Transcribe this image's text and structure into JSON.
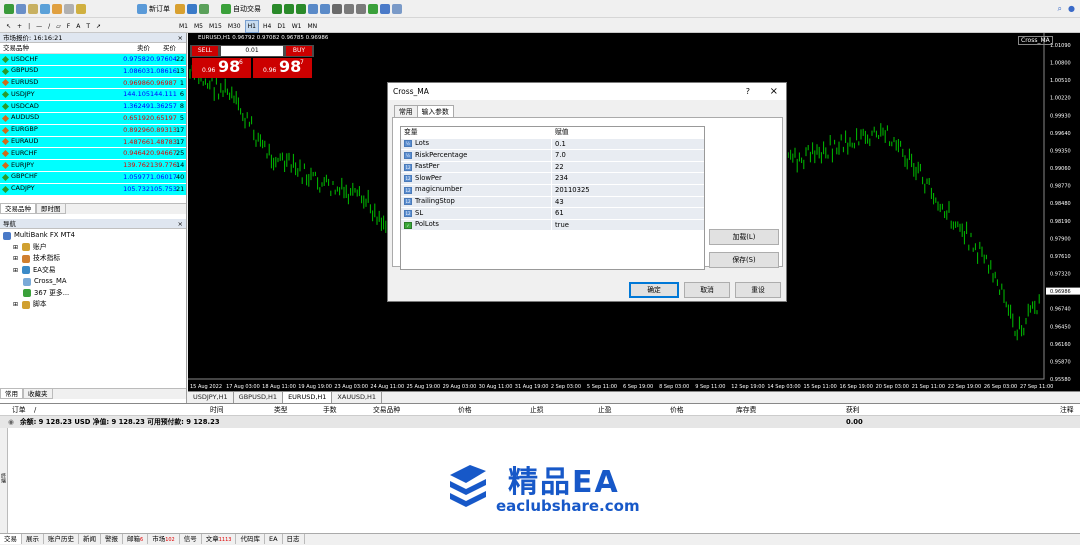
{
  "toolbar": {
    "new_order": "新订单",
    "auto_trading": "自动交易",
    "timeframes": [
      "M1",
      "M5",
      "M15",
      "M30",
      "H1",
      "H4",
      "D1",
      "W1",
      "MN"
    ]
  },
  "market_watch": {
    "title": "市场报价: 16:16:21",
    "close": "×",
    "headers": {
      "symbol": "交易品种",
      "bid": "卖价",
      "ask": "买价",
      "spread": ""
    },
    "rows": [
      {
        "symbol": "USDCHF",
        "bid": "0.97582",
        "ask": "0.97604",
        "spread": "22",
        "dir": "up"
      },
      {
        "symbol": "GBPUSD",
        "bid": "1.08603",
        "ask": "1.08616",
        "spread": "13",
        "dir": "up"
      },
      {
        "symbol": "EURUSD",
        "bid": "0.96986",
        "ask": "0.96987",
        "spread": "1",
        "dir": "down"
      },
      {
        "symbol": "USDJPY",
        "bid": "144.105",
        "ask": "144.111",
        "spread": "6",
        "dir": "up"
      },
      {
        "symbol": "USDCAD",
        "bid": "1.36249",
        "ask": "1.36257",
        "spread": "8",
        "dir": "up"
      },
      {
        "symbol": "AUDUSD",
        "bid": "0.65192",
        "ask": "0.65197",
        "spread": "5",
        "dir": "down"
      },
      {
        "symbol": "EURGBP",
        "bid": "0.89296",
        "ask": "0.89313",
        "spread": "17",
        "dir": "down"
      },
      {
        "symbol": "EURAUD",
        "bid": "1.48766",
        "ask": "1.48783",
        "spread": "17",
        "dir": "down"
      },
      {
        "symbol": "EURCHF",
        "bid": "0.94642",
        "ask": "0.94667",
        "spread": "25",
        "dir": "down"
      },
      {
        "symbol": "EURJPY",
        "bid": "139.762",
        "ask": "139.776",
        "spread": "14",
        "dir": "down"
      },
      {
        "symbol": "GBPCHF",
        "bid": "1.05977",
        "ask": "1.06017",
        "spread": "40",
        "dir": "up"
      },
      {
        "symbol": "CADJPY",
        "bid": "105.732",
        "ask": "105.753",
        "spread": "21",
        "dir": "up"
      }
    ],
    "tabs": [
      "交易品种",
      "即时图"
    ]
  },
  "navigator": {
    "title": "导航",
    "close": "×",
    "items": [
      {
        "label": "MultiBank FX MT4",
        "indent": 0,
        "icon": "terminal-icon"
      },
      {
        "label": "账户",
        "indent": 1,
        "icon": "accounts-icon"
      },
      {
        "label": "技术指标",
        "indent": 1,
        "icon": "indicators-icon"
      },
      {
        "label": "EA交易",
        "indent": 1,
        "icon": "expert-advisors-icon"
      },
      {
        "label": "Cross_MA",
        "indent": 2,
        "icon": "ea-icon"
      },
      {
        "label": "367 更多...",
        "indent": 2,
        "icon": "more-icon"
      },
      {
        "label": "脚本",
        "indent": 1,
        "icon": "scripts-icon"
      }
    ],
    "tabs": [
      "常用",
      "收藏夹"
    ]
  },
  "chart": {
    "header": "EURUSD,H1  0.96792 0.97082 0.96785 0.96986",
    "corner_label": "Cross_MA",
    "current_price": "0.96986",
    "sell": {
      "label": "SELL",
      "prefix": "0.96",
      "big": "98",
      "sup": "6"
    },
    "buy": {
      "label": "BUY",
      "prefix": "0.96",
      "big": "98",
      "sup": "7"
    },
    "lot": "0.01",
    "price_labels": [
      "1.01090",
      "1.00800",
      "1.00510",
      "1.00220",
      "0.99930",
      "0.99640",
      "0.99350",
      "0.99060",
      "0.98770",
      "0.98480",
      "0.98190",
      "0.97900",
      "0.97610",
      "0.97320",
      "0.96986",
      "0.96740",
      "0.96450",
      "0.96160",
      "0.95870",
      "0.95580"
    ],
    "time_labels": [
      "15 Aug 2022",
      "17 Aug 03:00",
      "18 Aug 11:00",
      "19 Aug 19:00",
      "23 Aug 03:00",
      "24 Aug 11:00",
      "25 Aug 19:00",
      "29 Aug 03:00",
      "30 Aug 11:00",
      "31 Aug 19:00",
      "2 Sep 03:00",
      "5 Sep 11:00",
      "6 Sep 19:00",
      "8 Sep 03:00",
      "9 Sep 11:00",
      "12 Sep 19:00",
      "14 Sep 03:00",
      "15 Sep 11:00",
      "16 Sep 19:00",
      "20 Sep 03:00",
      "21 Sep 11:00",
      "22 Sep 19:00",
      "26 Sep 03:00",
      "27 Sep 11:00"
    ],
    "tabs": [
      "USDJPY,H1",
      "GBPUSD,H1",
      "EURUSD,H1",
      "XAUUSD,H1"
    ],
    "active_tab": 2
  },
  "dialog": {
    "title": "Cross_MA",
    "help": "?",
    "close": "×",
    "tabs": [
      "常用",
      "输入参数"
    ],
    "active_tab": 1,
    "headers": {
      "name": "变量",
      "value": "赋值"
    },
    "params": [
      {
        "name": "Lots",
        "value": "0.1",
        "type": "num"
      },
      {
        "name": "RiskPercentage",
        "value": "7.0",
        "type": "num"
      },
      {
        "name": "FastPer",
        "value": "22",
        "type": "int"
      },
      {
        "name": "SlowPer",
        "value": "234",
        "type": "int"
      },
      {
        "name": "magicnumber",
        "value": "20110325",
        "type": "int"
      },
      {
        "name": "TrailingStop",
        "value": "43",
        "type": "int"
      },
      {
        "name": "SL",
        "value": "61",
        "type": "int"
      },
      {
        "name": "PolLots",
        "value": "true",
        "type": "bool"
      }
    ],
    "load_label": "加载(L)",
    "save_label": "保存(S)",
    "ok_label": "确定",
    "cancel_label": "取消",
    "reset_label": "重设"
  },
  "terminal": {
    "headers": [
      "订单",
      "/",
      "时间",
      "类型",
      "手数",
      "交易品种",
      "价格",
      "止损",
      "止盈",
      "价格",
      "库存费",
      "获利",
      "注释"
    ],
    "balance_text": "余额: 9 128.23 USD  净值: 9 128.23  可用预付款: 9 128.23",
    "profit": "0.00",
    "tabs": [
      {
        "label": "交易"
      },
      {
        "label": "展示"
      },
      {
        "label": "账户历史"
      },
      {
        "label": "新闻"
      },
      {
        "label": "警报"
      },
      {
        "label": "邮箱",
        "badge": "6"
      },
      {
        "label": "市场",
        "badge": "102"
      },
      {
        "label": "信号"
      },
      {
        "label": "文章",
        "badge": "1113"
      },
      {
        "label": "代码库"
      },
      {
        "label": "EA"
      },
      {
        "label": "日志"
      }
    ],
    "side_label": "终端"
  },
  "watermark": {
    "title": "精品EA",
    "url": "eaclubshare.com"
  },
  "colors": {
    "chart_bg": "#000000",
    "candle": "#00c000",
    "grid": "#3a4a3a",
    "cyan": "#00ffff",
    "sell_red": "#cc0000",
    "buy_red": "#cc0000",
    "watermark_blue": "#1758c8"
  }
}
